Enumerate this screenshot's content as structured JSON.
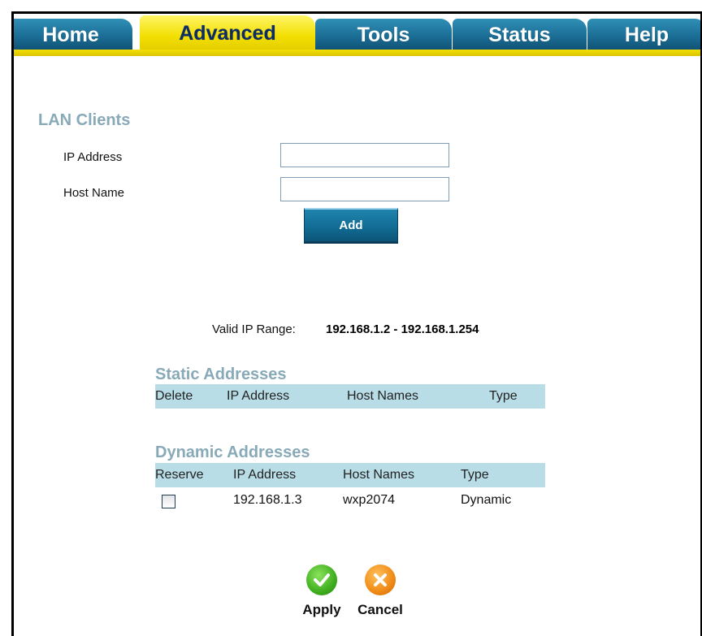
{
  "tabs": [
    {
      "label": "Home"
    },
    {
      "label": "Advanced"
    },
    {
      "label": "Tools"
    },
    {
      "label": "Status"
    },
    {
      "label": "Help"
    }
  ],
  "active_tab": "Advanced",
  "lan_clients": {
    "title": "LAN Clients",
    "ip_label": "IP Address",
    "ip_value": "",
    "host_label": "Host Name",
    "host_value": "",
    "add_label": "Add"
  },
  "valid_range": {
    "label": "Valid IP Range:",
    "value": "192.168.1.2 -  192.168.1.254"
  },
  "static": {
    "title": "Static Addresses",
    "headers": [
      "Delete",
      "IP Address",
      "Host Names",
      "Type"
    ],
    "rows": []
  },
  "dynamic": {
    "title": "Dynamic Addresses",
    "headers": [
      "Reserve",
      "IP Address",
      "Host Names",
      "Type"
    ],
    "rows": [
      {
        "reserve": false,
        "ip": "192.168.1.3",
        "host": "wxp2074",
        "type": "Dynamic"
      }
    ]
  },
  "actions": {
    "apply_label": "Apply",
    "cancel_label": "Cancel"
  },
  "colors": {
    "tab_blue": "#1b6d95",
    "tab_yellow": "#f2de00",
    "section_title": "#88a9b8",
    "table_header": "#b9dde7",
    "apply_green": "#3fae1f",
    "cancel_orange": "#f08a17"
  }
}
